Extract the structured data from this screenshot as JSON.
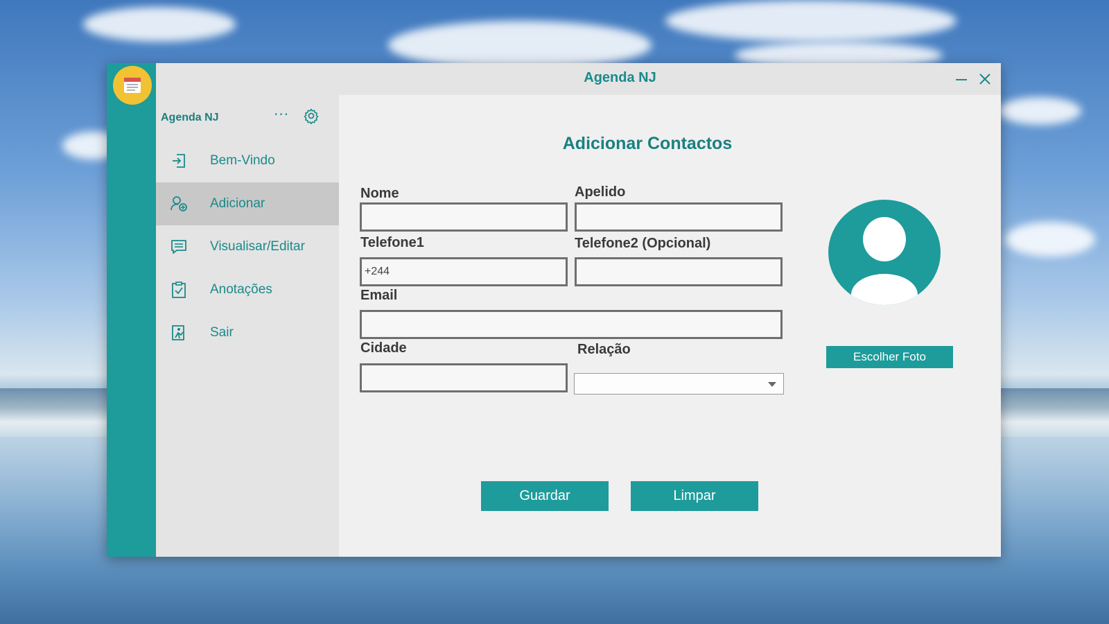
{
  "window": {
    "title": "Agenda NJ"
  },
  "sidebar": {
    "header": "Agenda NJ",
    "more_label": "···",
    "items": [
      {
        "label": "Bem-Vindo",
        "icon": "login-icon",
        "active": false
      },
      {
        "label": "Adicionar",
        "icon": "add-user-icon",
        "active": true
      },
      {
        "label": "Visualisar/Editar",
        "icon": "message-list-icon",
        "active": false
      },
      {
        "label": "Anotações",
        "icon": "clipboard-check-icon",
        "active": false
      },
      {
        "label": "Sair",
        "icon": "exit-icon",
        "active": false
      }
    ]
  },
  "form": {
    "heading": "Adicionar Contactos",
    "nome": {
      "label": "Nome",
      "value": ""
    },
    "apelido": {
      "label": "Apelido",
      "value": ""
    },
    "telefone1": {
      "label": "Telefone1",
      "value": "+244"
    },
    "telefone2": {
      "label": "Telefone2 (Opcional)",
      "value": ""
    },
    "email": {
      "label": "Email",
      "value": ""
    },
    "cidade": {
      "label": "Cidade",
      "value": ""
    },
    "relacao": {
      "label": "Relação",
      "value": ""
    },
    "choose_photo": "Escolher Foto",
    "save": "Guardar",
    "clear": "Limpar"
  },
  "colors": {
    "accent": "#1e9b9b",
    "logo": "#f2c233",
    "text_accent": "#1a8080"
  }
}
